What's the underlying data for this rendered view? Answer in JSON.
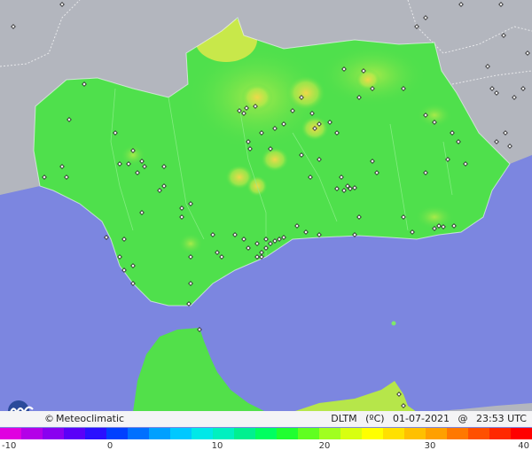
{
  "brand": {
    "copyright": "©",
    "name": "Meteoclimatic",
    "logo_icon": "meteoclimatic-logo-icon"
  },
  "map_info": {
    "variable": "DLTM",
    "unit": "(ºC)",
    "date": "01-07-2021",
    "separator": "@",
    "time": "23:53 UTC"
  },
  "colorbar": {
    "ticks": [
      "-10",
      "0",
      "10",
      "20",
      "30",
      "40"
    ],
    "min": -10,
    "max": 40,
    "colors": [
      "#e000e0",
      "#b400e8",
      "#8a00f0",
      "#5a00f8",
      "#2a10ff",
      "#0040ff",
      "#0070ff",
      "#00a0ff",
      "#00c8ff",
      "#00e8e8",
      "#00f0c0",
      "#00f090",
      "#00ff60",
      "#20ff30",
      "#60ff20",
      "#a0ff20",
      "#d8ff10",
      "#ffff00",
      "#ffe000",
      "#ffc000",
      "#ffa000",
      "#ff7800",
      "#ff5000",
      "#ff2800",
      "#ff0000"
    ]
  },
  "colors": {
    "sea": "#7c86e0",
    "land_outside": "#b3b6be",
    "land_main": "#4fe04c",
    "land_warm": "#8ee84a",
    "land_hot": "#e6e24a",
    "station_marker": "#ffffff"
  }
}
